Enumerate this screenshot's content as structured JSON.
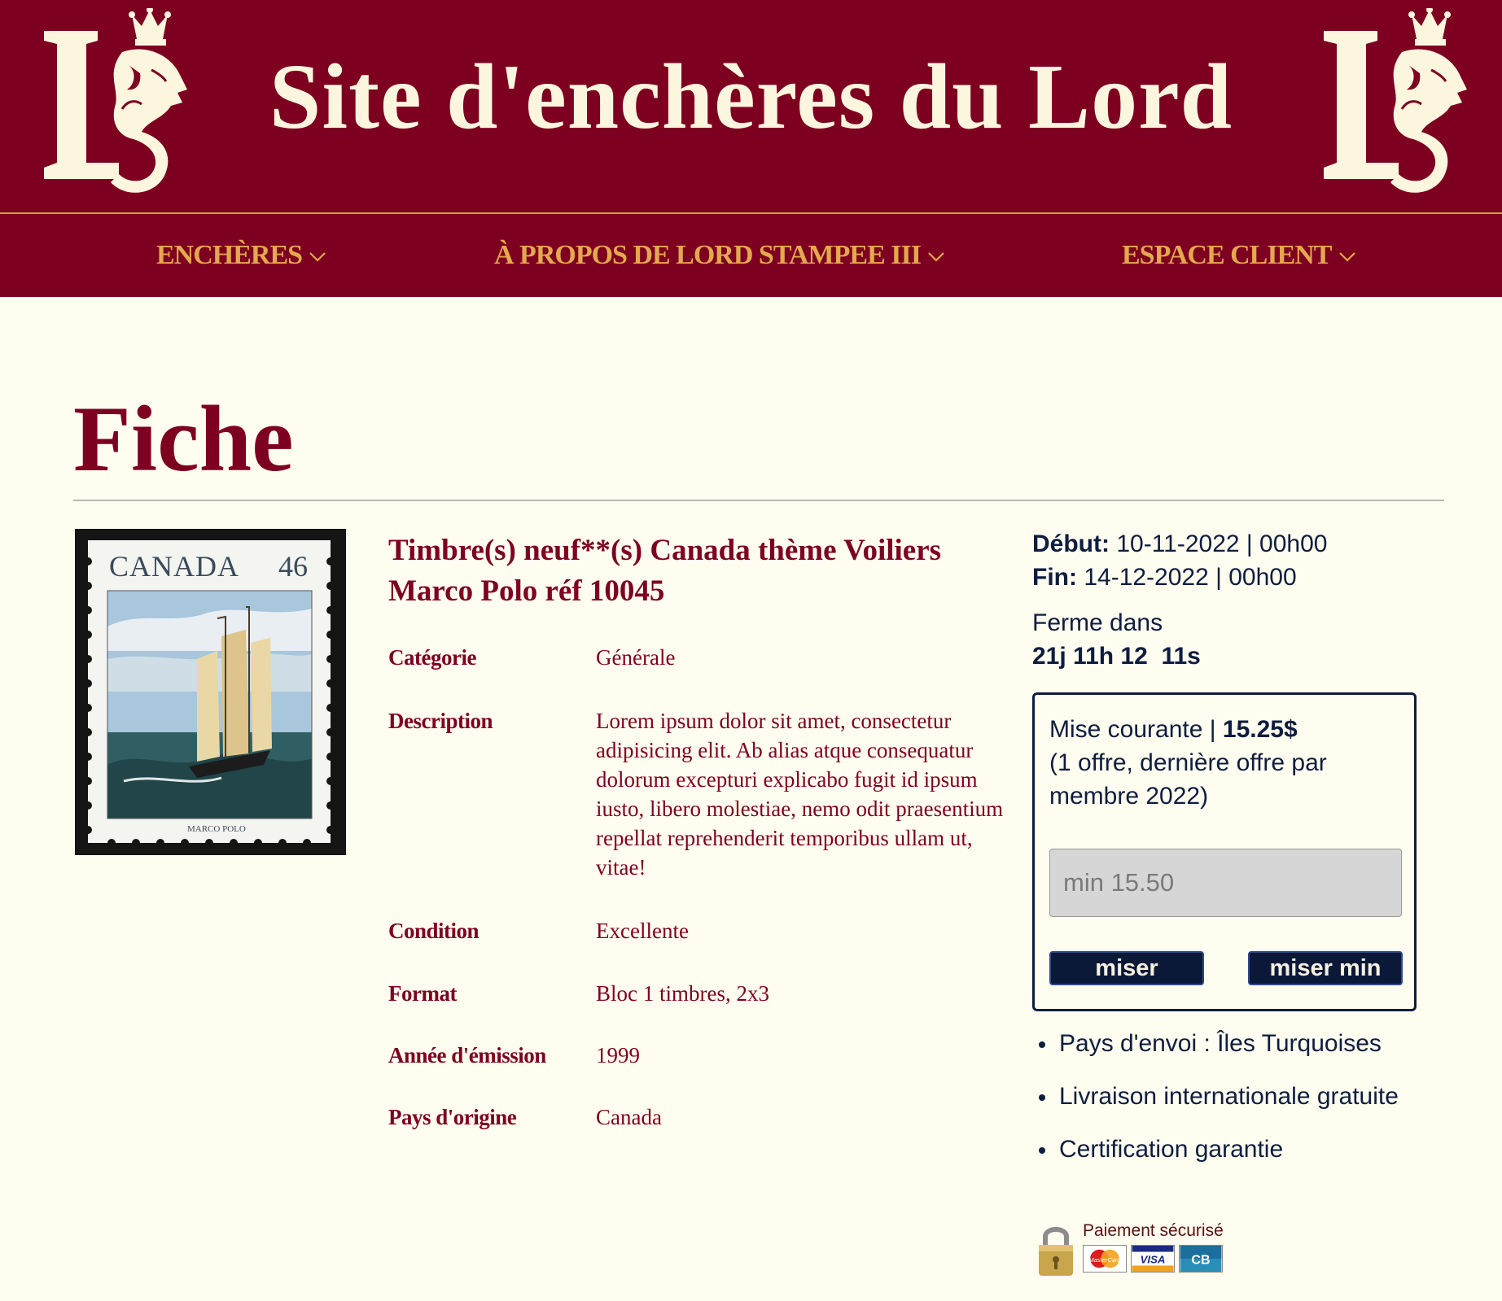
{
  "site": {
    "title": "Site d'enchères du Lord",
    "logo_icon": "lion-crown-ls-logo-icon",
    "brand_color": "#7e0020",
    "nav_color": "#e2a94e"
  },
  "nav": {
    "items": [
      {
        "label": "ENCHÈRES"
      },
      {
        "label": "À PROPOS DE LORD STAMPEE III"
      },
      {
        "label": "ESPACE CLIENT"
      }
    ]
  },
  "page": {
    "title": "Fiche"
  },
  "stamp": {
    "country": "CANADA",
    "value": "46",
    "caption": "MARCO POLO"
  },
  "product": {
    "title": "Timbre(s) neuf**(s) Canada thème Voiliers Marco Polo réf 10045",
    "details": [
      {
        "label": "Catégorie",
        "value": "Générale"
      },
      {
        "label": "Description",
        "value": "Lorem ipsum dolor sit amet, consectetur adipisicing elit. Ab alias atque consequatur dolorum excepturi explicabo fugit id ipsum iusto, libero molestiae, nemo odit praesentium repellat reprehenderit temporibus ullam ut, vitae!"
      },
      {
        "label": "Condition",
        "value": "Excellente"
      },
      {
        "label": "Format",
        "value": "Bloc 1 timbres, 2x3"
      },
      {
        "label": "Année d'émission",
        "value": "1999"
      },
      {
        "label": "Pays d'origine",
        "value": "Canada"
      }
    ]
  },
  "auction": {
    "start_label": "Début:",
    "start_value": "10-11-2022 | 00h00",
    "end_label": "Fin:",
    "end_value": "14-12-2022 | 00h00",
    "closes_label": "Ferme dans",
    "countdown": "21j 11h 12  11s",
    "current_label": "Mise courante | ",
    "current_value": "15.25$",
    "offers_text": "(1 offre, dernière offre par membre 2022)",
    "input_placeholder": "min 15.50",
    "bid_button": "miser",
    "min_button": "miser min"
  },
  "features": [
    "Pays d'envoi : Îles Turquoises",
    "Livraison internationale gratuite",
    "Certification garantie"
  ],
  "payment": {
    "label": "Paiement sécurisé",
    "cards": [
      "MasterCard",
      "VISA",
      "CB"
    ]
  }
}
